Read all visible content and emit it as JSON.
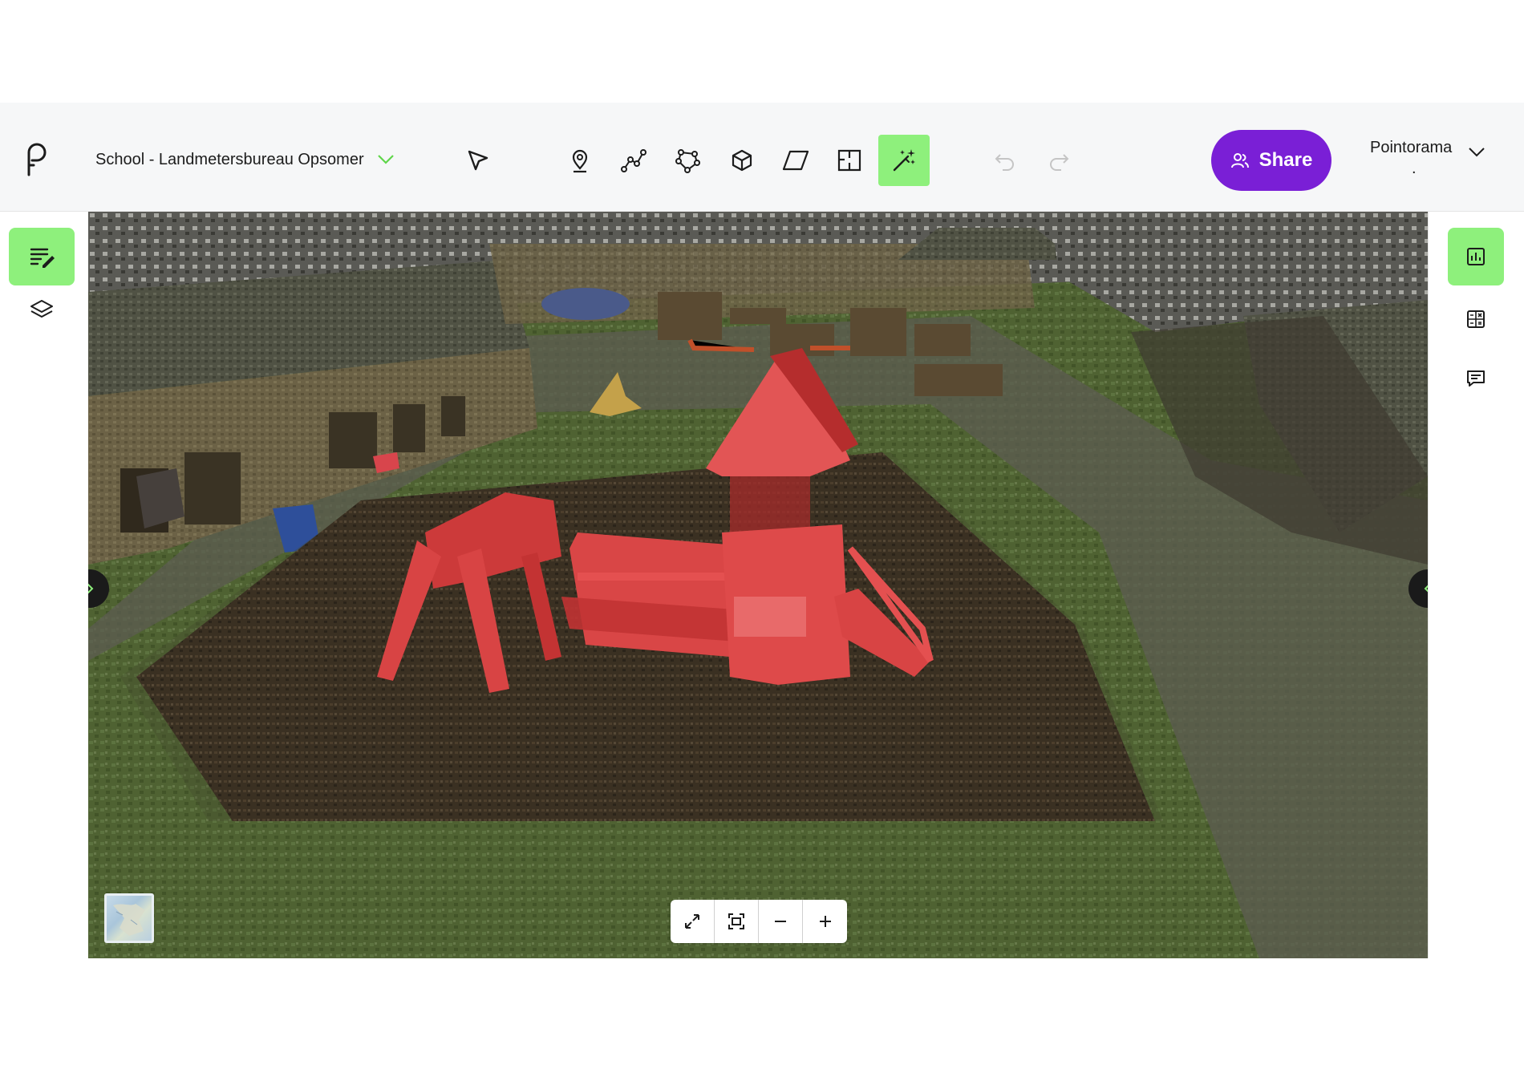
{
  "header": {
    "project_name": "School - Landmetersbureau Opsomer",
    "share_label": "Share",
    "user_name": "Pointorama",
    "user_sub": "."
  },
  "toolbar": {
    "tools": [
      "select-tool",
      "point-tool",
      "polyline-tool",
      "polygon-tool",
      "box-tool",
      "plane-tool",
      "section-tool",
      "auto-classify-tool"
    ],
    "active_tool": "auto-classify-tool"
  },
  "colors": {
    "accent_green": "#8ef07c",
    "share_purple": "#7a1fd6",
    "highlight_red": "#d63a3a"
  },
  "left_rail": [
    "edit-list-icon",
    "layers-icon"
  ],
  "right_rail": [
    "stats-icon",
    "calculator-icon",
    "comment-icon"
  ],
  "viewport_controls": [
    "fullscreen-icon",
    "focus-icon",
    "zoom-out-icon",
    "zoom-in-icon"
  ]
}
